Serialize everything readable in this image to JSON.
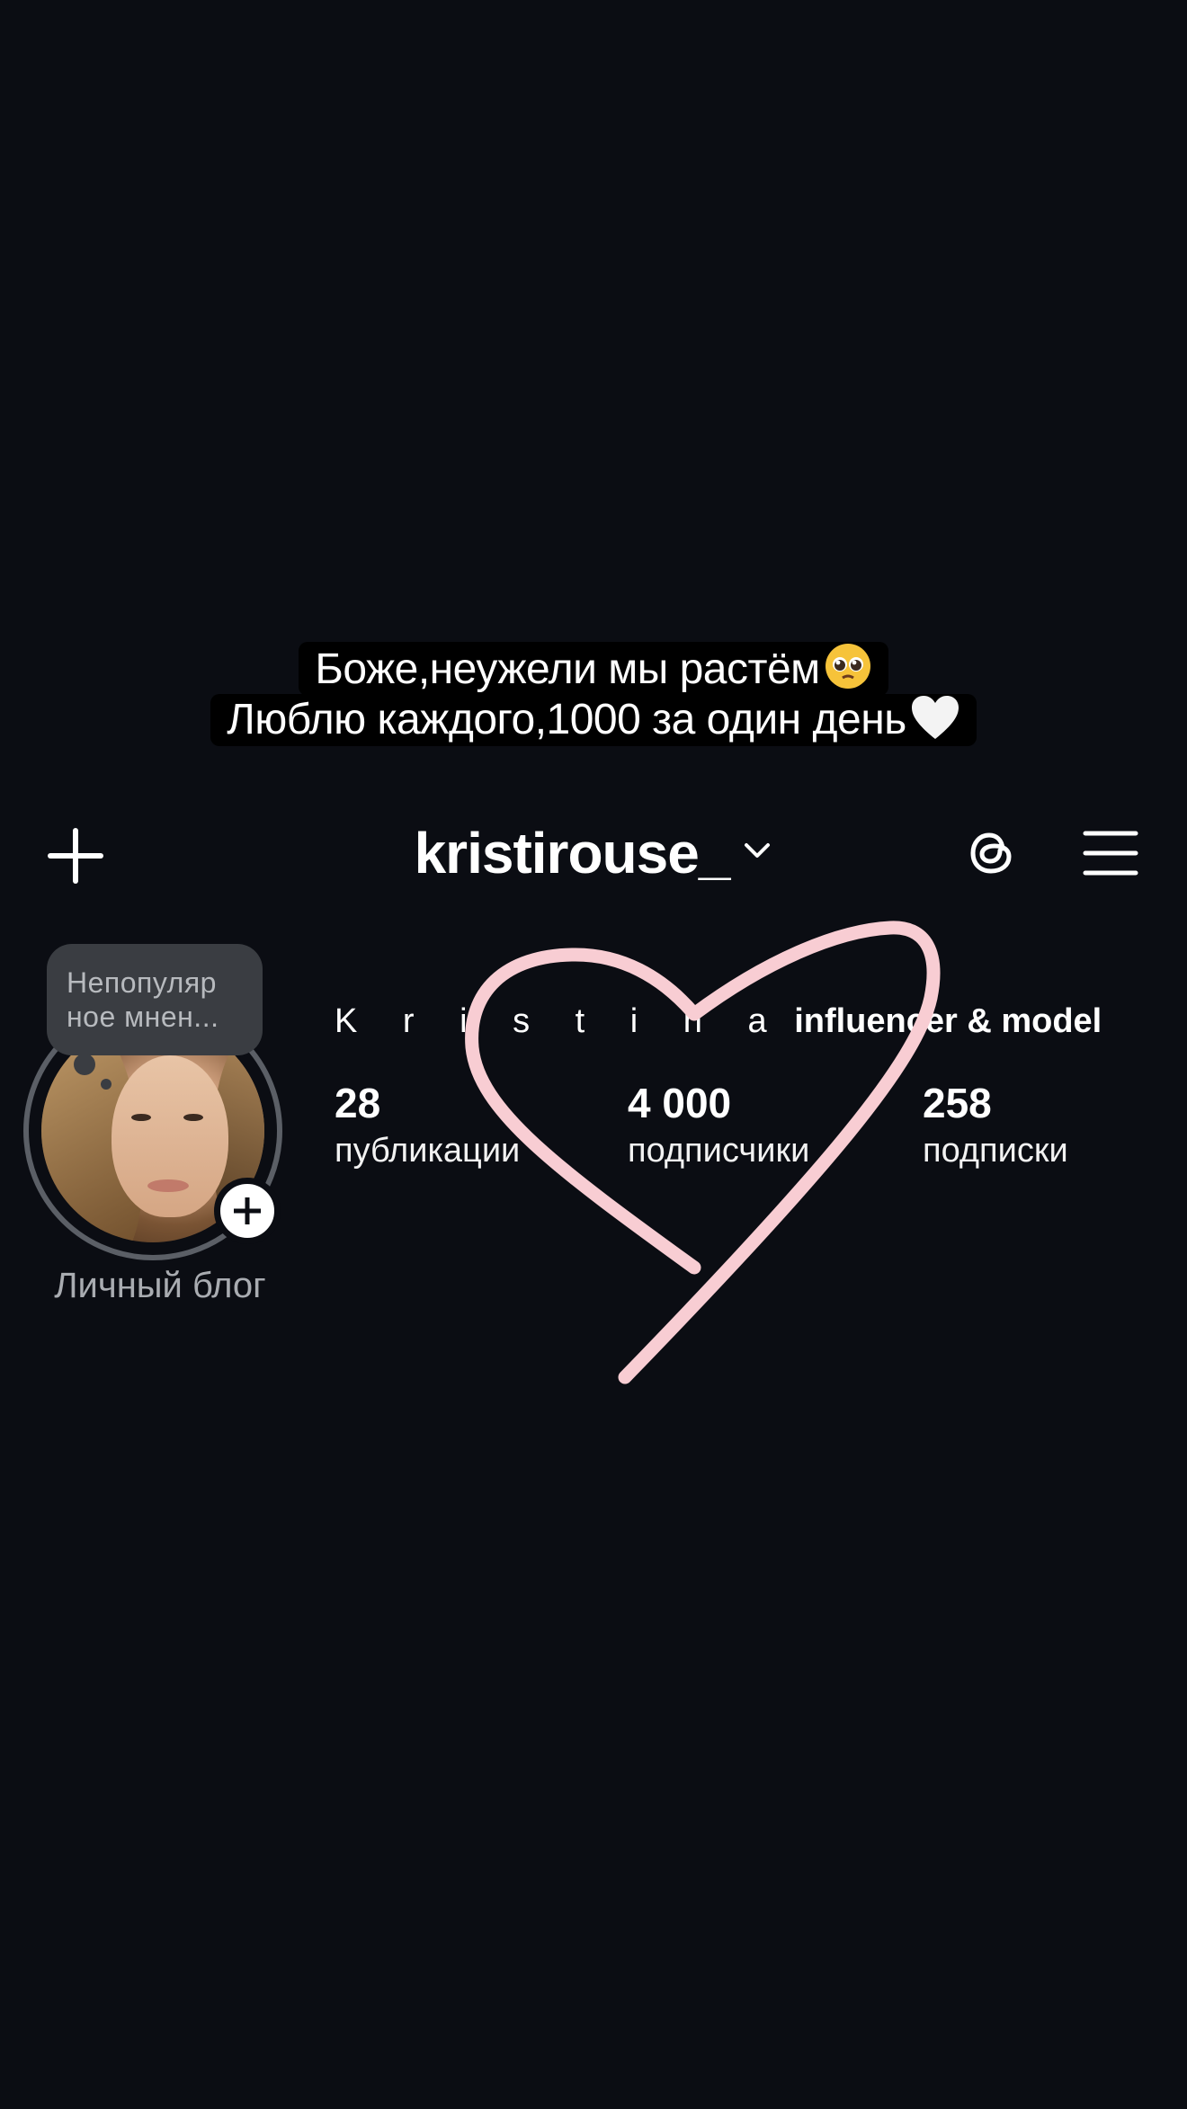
{
  "caption": {
    "line1": "Боже,неужели мы растём",
    "line2": "Люблю каждого,1000 за один день",
    "line1_emoji": "pleading-face-emoji",
    "line2_emoji": "white-heart-emoji"
  },
  "header": {
    "username": "kristirouse_",
    "icons": [
      "plus-icon",
      "chevron-down-icon",
      "threads-icon",
      "menu-icon"
    ]
  },
  "profile": {
    "note": {
      "line1": "Непопуляр",
      "line2": "ное мнен..."
    },
    "category": "Личный блог",
    "bio_name_spaced": "K r i s t i n a",
    "bio_rest": "influencer & model",
    "stats": [
      {
        "value": "28",
        "label": "публикации"
      },
      {
        "value": "4 000",
        "label": "подписчики"
      },
      {
        "value": "258",
        "label": "подписки"
      }
    ]
  },
  "colors": {
    "background": "#0b0d13",
    "caption_bg": "#000000",
    "heart_stroke": "#f8cdd3",
    "note_bg": "#3a3d42",
    "muted_text": "#a9acb1"
  }
}
